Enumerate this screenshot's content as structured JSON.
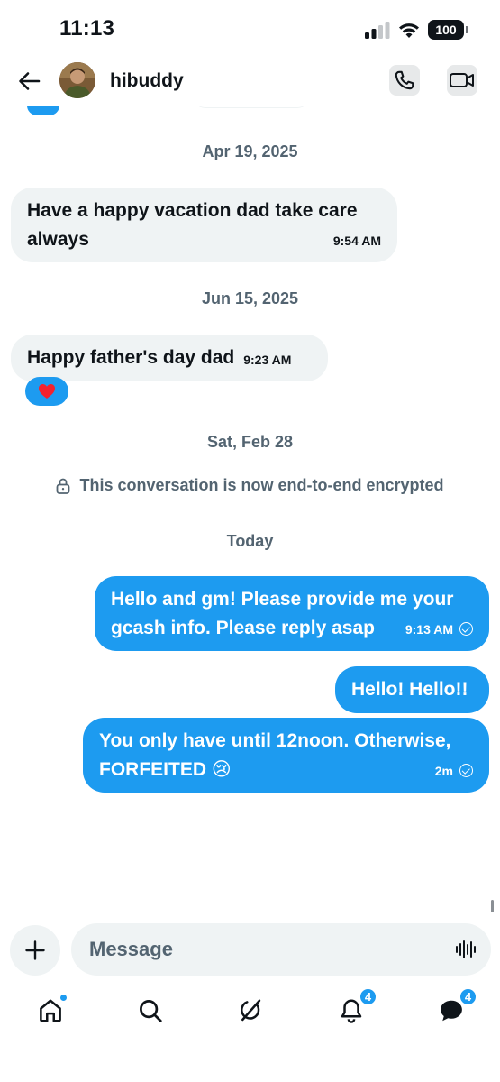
{
  "status_bar": {
    "time": "11:13",
    "battery": "100"
  },
  "header": {
    "contact_name": "hibuddy"
  },
  "chat": {
    "dates": {
      "apr19": "Apr 19, 2025",
      "jun15": "Jun 15, 2025",
      "feb28": "Sat, Feb 28",
      "today": "Today"
    },
    "encryption_notice": "This conversation is now end-to-end encrypted",
    "messages": [
      {
        "direction": "incoming",
        "text_line1": "Have a happy vacation dad take care",
        "text_line2": "always",
        "time": "9:54 AM"
      },
      {
        "direction": "incoming",
        "text": "Happy father's day dad",
        "time": "9:23 AM",
        "reaction": "❤️"
      },
      {
        "direction": "outgoing",
        "text_line1": "Hello and gm! Please provide me your",
        "text_line2": "gcash info. Please reply asap",
        "time": "9:13 AM",
        "status": "seen"
      },
      {
        "direction": "outgoing",
        "text": "Hello! Hello!!"
      },
      {
        "direction": "outgoing",
        "text_line1": "You only have until 12noon. Otherwise,",
        "text_line2": "FORFEITED 😢",
        "time": "2m",
        "status": "seen"
      }
    ]
  },
  "composer": {
    "placeholder": "Message"
  },
  "bottom_nav": {
    "items": [
      "home-icon",
      "search-icon",
      "grok-icon",
      "notifications-icon",
      "messages-icon"
    ],
    "notifications_badge": "4",
    "messages_badge": "4"
  },
  "colors": {
    "accent": "#1d9bf0",
    "incoming_bubble": "#eff3f4",
    "secondary_text": "#536471"
  }
}
